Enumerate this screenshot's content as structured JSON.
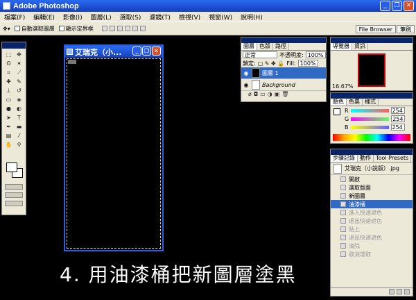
{
  "app": {
    "title": "Adobe Photoshop"
  },
  "menu": {
    "items": [
      "檔案(F)",
      "編輯(E)",
      "影像(I)",
      "圖層(L)",
      "選取(S)",
      "濾鏡(T)",
      "檢視(V)",
      "視窗(W)",
      "說明(H)"
    ]
  },
  "options": {
    "auto_select": "自動選取圖層",
    "show_bounds": "顯示定界框"
  },
  "tab_well": {
    "file_browser": "File Browser",
    "brushes": "筆刷"
  },
  "document": {
    "title": "艾瑞克（小..."
  },
  "layers_panel": {
    "tabs": [
      "圖層",
      "色版",
      "路徑"
    ],
    "blend_mode": "正常",
    "opacity_label": "不透明度:",
    "opacity_value": "100%",
    "lock_label": "鎖定:",
    "fill_label": "Fill:",
    "fill_value": "100%",
    "layers": [
      {
        "name": "圖層 1",
        "active": true
      },
      {
        "name": "Background",
        "active": false
      }
    ]
  },
  "navigator": {
    "tabs": [
      "導覽器",
      "資訊"
    ],
    "zoom": "16.67%"
  },
  "color_panel": {
    "tabs": [
      "顏色",
      "色票",
      "樣式"
    ],
    "channels": [
      {
        "label": "R",
        "value": "254",
        "color": "#ff6060"
      },
      {
        "label": "G",
        "value": "254",
        "color": "#60ff60"
      },
      {
        "label": "B",
        "value": "254",
        "color": "#6060ff"
      }
    ]
  },
  "history_panel": {
    "tabs": [
      "步驟記錄",
      "動作",
      "Tool Presets"
    ],
    "snapshot": "艾瑞克（小說版）.jpg",
    "items": [
      {
        "label": "開啟",
        "state": "normal"
      },
      {
        "label": "選取版面",
        "state": "normal"
      },
      {
        "label": "新圖層",
        "state": "normal"
      },
      {
        "label": "油漆桶",
        "state": "active"
      },
      {
        "label": "進入快速遮色",
        "state": "dim"
      },
      {
        "label": "退出快速遮色",
        "state": "dim"
      },
      {
        "label": "貼上",
        "state": "dim"
      },
      {
        "label": "退出快速遮色",
        "state": "dim"
      },
      {
        "label": "清除",
        "state": "dim"
      },
      {
        "label": "取消選取",
        "state": "dim"
      }
    ]
  },
  "caption": {
    "text": "4. 用油漆桶把新圖層塗黑"
  }
}
